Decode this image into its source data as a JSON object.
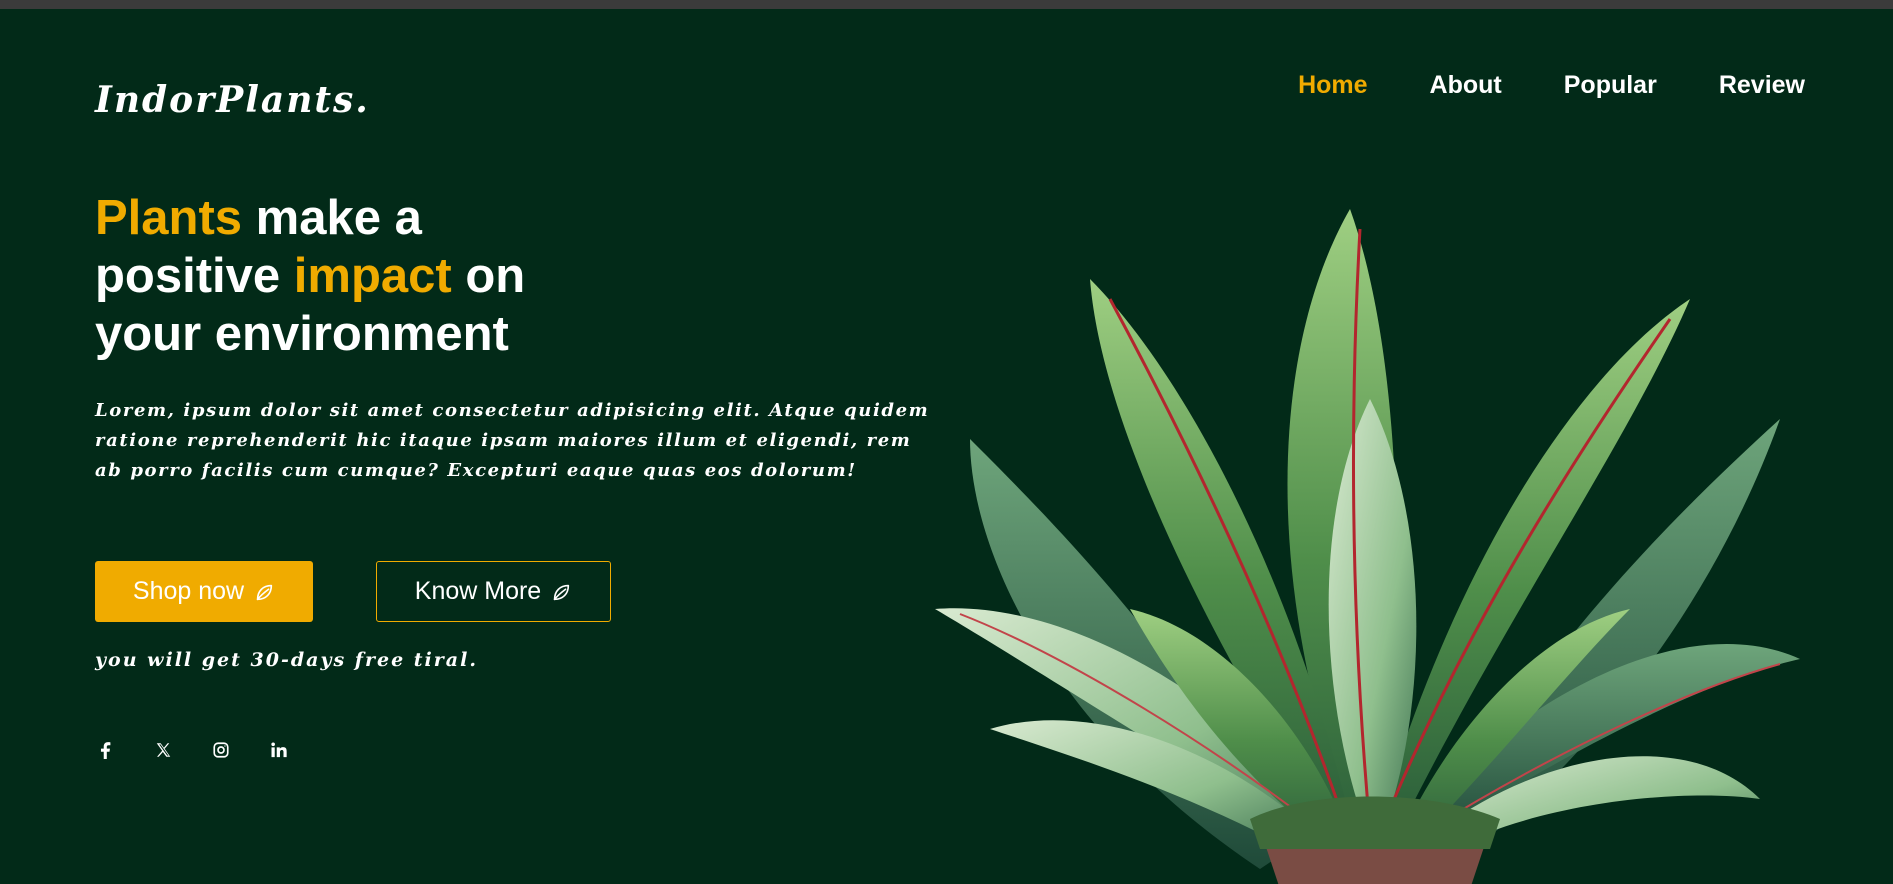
{
  "brand": {
    "logo": "IndorPlants."
  },
  "nav": {
    "items": [
      "Home",
      "About",
      "Popular",
      "Review"
    ],
    "active": "Home"
  },
  "hero": {
    "headline": {
      "word1": "Plants",
      "text1": " make a",
      "text2": "positive ",
      "word2": "impact",
      "text3": " on",
      "text4": "your environment"
    },
    "description": "Lorem, ipsum dolor sit amet consectetur adipisicing elit. Atque quidem ratione reprehenderit hic itaque ipsam maiores illum et eligendi, rem ab porro facilis cum cumque? Excepturi eaque quas eos dolorum!",
    "buttons": {
      "shop_label": "Shop now",
      "know_label": "Know More"
    },
    "trial": "you will get 30-days free tiral."
  },
  "social": [
    "facebook-icon",
    "x-icon",
    "instagram-icon",
    "linkedin-icon"
  ],
  "colors": {
    "background": "#022a18",
    "accent": "#f0ab00",
    "text": "#ffffff"
  }
}
